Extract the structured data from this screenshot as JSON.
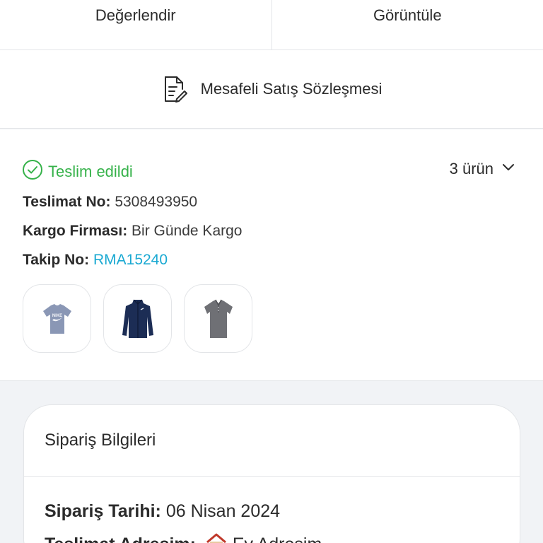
{
  "top_actions": [
    {
      "label": "Değerlendir"
    },
    {
      "label": "Görüntüle"
    }
  ],
  "contract": {
    "icon": "document-edit-icon",
    "label": "Mesafeli Satış Sözleşmesi"
  },
  "shipment": {
    "status_icon": "check-circle-icon",
    "status": "Teslim edildi",
    "item_count": "3 ürün",
    "toggle_icon": "chevron-down-icon",
    "delivery_no_label": "Teslimat No:",
    "delivery_no": "5308493950",
    "carrier_label": "Kargo Firması:",
    "carrier": "Bir Günde Kargo",
    "tracking_label": "Takip No:",
    "tracking_no": "RMA15240",
    "products": [
      {
        "name": "grey-tshirt-thumbnail"
      },
      {
        "name": "navy-jacket-thumbnail"
      },
      {
        "name": "grey-polo-thumbnail"
      }
    ]
  },
  "order_info": {
    "title": "Sipariş Bilgileri",
    "date_label": "Sipariş Tarihi:",
    "date": "06 Nisan 2024",
    "address_label": "Teslimat Adresim:",
    "address_icon": "house-icon",
    "address": "Ev Adresim"
  },
  "colors": {
    "success": "#36b24a",
    "link": "#1aa9d2",
    "text": "#2b2b2b",
    "border": "#e3e5e8",
    "page_bg": "#f1f3f6"
  }
}
